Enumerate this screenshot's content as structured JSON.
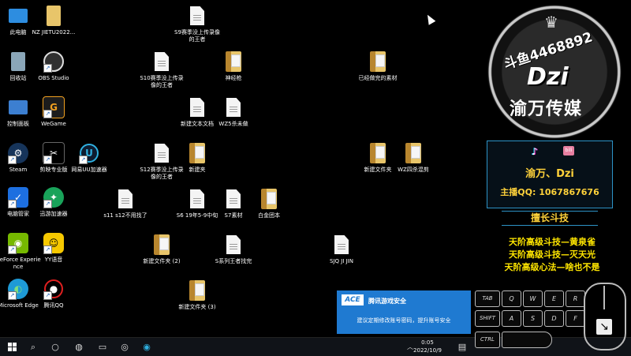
{
  "desktop": {
    "icons": [
      {
        "label": "此电脑"
      },
      {
        "label": "NZ JIETU2022..."
      },
      {
        "label": "S9赛季没上传录像的王者"
      },
      {
        "label": "回收站"
      },
      {
        "label": "OBS Studio"
      },
      {
        "label": "S10赛季没上传录像的王者"
      },
      {
        "label": "神经枪"
      },
      {
        "label": "已经做完的素材"
      },
      {
        "label": "控制面板"
      },
      {
        "label": "WeGame"
      },
      {
        "label": "新建文本文档"
      },
      {
        "label": "WZ5杀未做"
      },
      {
        "label": "Steam"
      },
      {
        "label": "剪映专业版"
      },
      {
        "label": "网易UU加速器"
      },
      {
        "label": "S12赛季没上传录像的王者"
      },
      {
        "label": "新建夹"
      },
      {
        "label": "新建文件夹"
      },
      {
        "label": "WZ四杀混剪"
      },
      {
        "label": "电脑管家"
      },
      {
        "label": "迅游加速器"
      },
      {
        "label": "s11 s12不用找了"
      },
      {
        "label": "S6 19年5-9中旬"
      },
      {
        "label": "S7素材"
      },
      {
        "label": "白金团本"
      },
      {
        "label": "GeForce Experience"
      },
      {
        "label": "YY语音"
      },
      {
        "label": "新建文件夹 (2)"
      },
      {
        "label": "S系列王者找完"
      },
      {
        "label": "SJQ JI JIN"
      },
      {
        "label": "Microsoft Edge"
      },
      {
        "label": "腾讯QQ"
      },
      {
        "label": "新建文件夹 (3)"
      }
    ]
  },
  "toast": {
    "logo": "ACE",
    "title": "腾讯游戏安全",
    "message": "建议定期修改账号密码，提升账号安全"
  },
  "taskbar": {
    "time": "0:05",
    "date": "2022/10/9"
  },
  "overlay": {
    "logo_top": "斗鱼4468892",
    "logo_mid": "Dzi",
    "logo_bottom": "渝万传媒",
    "bili": "bili",
    "name": "渝万、Dzi",
    "qq": "主播QQ: 1067867676",
    "specialty": "擅长斗技",
    "skills": [
      "天阶高级斗技—黄泉雀",
      "天阶高级斗技—灭天光",
      "天阶高级心法—啥也不是"
    ],
    "keys_row1": [
      "TAB",
      "Q",
      "W",
      "E",
      "R"
    ],
    "keys_row2": [
      "SHIFT",
      "A",
      "S",
      "D",
      "F"
    ],
    "keys_row3": [
      "CTRL"
    ]
  }
}
